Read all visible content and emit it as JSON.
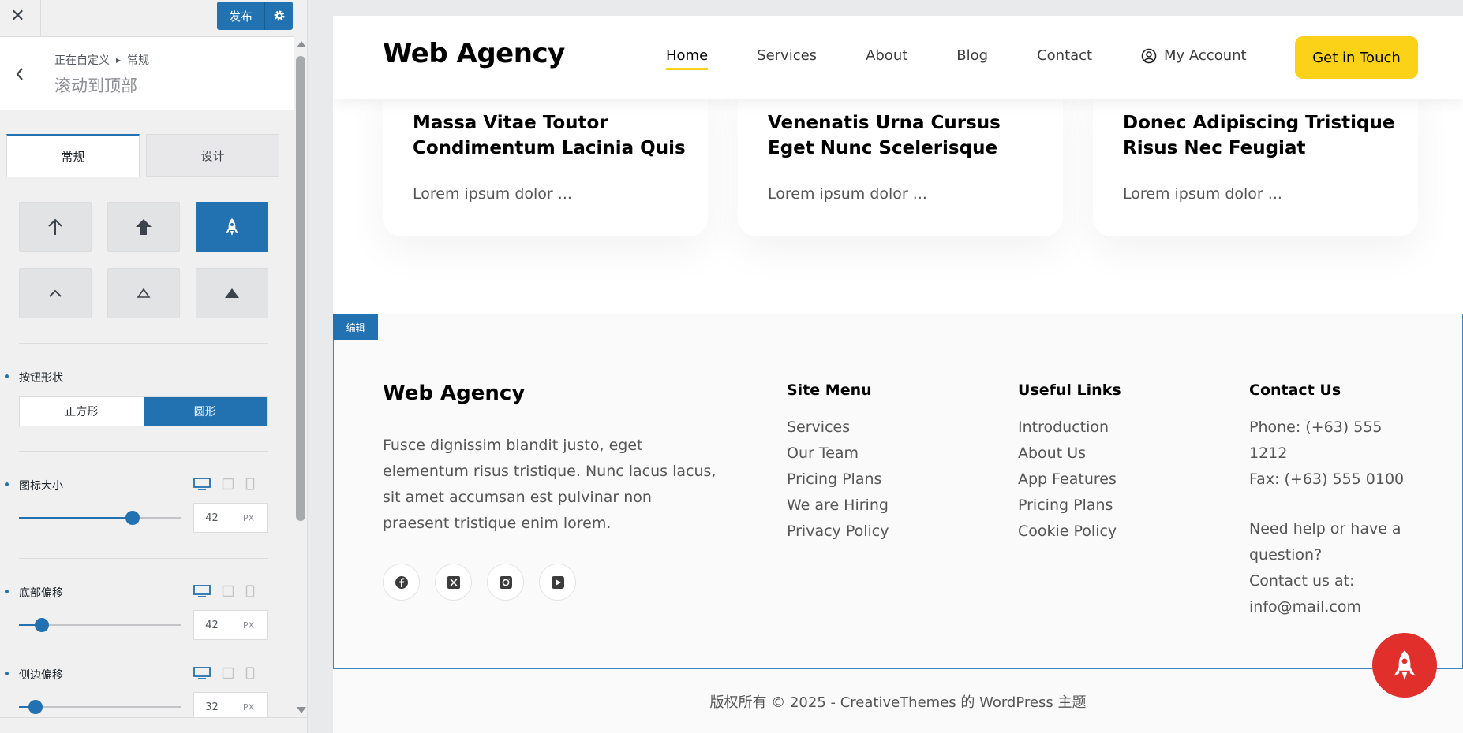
{
  "customizer": {
    "close_glyph": "✕",
    "publish_label": "发布",
    "breadcrumb": [
      "正在自定义",
      "常规"
    ],
    "section_title": "滚动到顶部",
    "tabs": [
      "常规",
      "设计"
    ],
    "accent_color": "#2271b1",
    "icon_options": [
      "arrow-up-thin-icon",
      "arrow-up-bold-icon",
      "rocket-icon",
      "chevron-up-icon",
      "triangle-outline-up-icon",
      "triangle-solid-up-icon"
    ],
    "selected_icon": "rocket-icon",
    "button_shape": {
      "label": "按钮形状",
      "options": [
        "正方形",
        "圆形"
      ],
      "selected": "圆形"
    },
    "icon_size": {
      "label": "图标大小",
      "value": "42",
      "unit": "PX",
      "level": 0.7
    },
    "bottom_offset": {
      "label": "底部偏移",
      "value": "42",
      "unit": "PX",
      "level": 0.14
    },
    "side_offset": {
      "label": "侧边偏移",
      "value": "32",
      "unit": "PX",
      "level": 0.1
    }
  },
  "site": {
    "logo": "Web Agency",
    "nav": [
      "Home",
      "Services",
      "About",
      "Blog",
      "Contact"
    ],
    "nav_current": "Home",
    "account": "My Account",
    "cta": "Get in Touch",
    "cta_color": "#fcd219",
    "cards": [
      {
        "title": "Massa Vitae Toutor Condimentum Lacinia Quis",
        "excerpt": "Lorem ipsum dolor ..."
      },
      {
        "title": "Venenatis Urna Cursus Eget Nunc Scelerisque",
        "excerpt": "Lorem ipsum dolor ..."
      },
      {
        "title": "Donec Adipiscing Tristique Risus Nec Feugiat",
        "excerpt": "Lorem ipsum dolor ..."
      }
    ],
    "footer": {
      "edit_tag": "编辑",
      "logo": "Web Agency",
      "description": "Fusce dignissim blandit justo, eget elementum risus tristique. Nunc lacus lacus, sit amet accumsan est pulvinar non praesent tristique enim lorem.",
      "socials": [
        "facebook-icon",
        "x-icon",
        "instagram-icon",
        "youtube-icon"
      ],
      "site_menu": {
        "heading": "Site Menu",
        "links": [
          "Services",
          "Our Team",
          "Pricing Plans",
          "We are Hiring",
          "Privacy Policy"
        ]
      },
      "useful_links": {
        "heading": "Useful Links",
        "links": [
          "Introduction",
          "About Us",
          "App Features",
          "Pricing Plans",
          "Cookie Policy"
        ]
      },
      "contact": {
        "heading": "Contact Us",
        "phone": "Phone: (+63) 555 1212",
        "fax": "Fax: (+63) 555 0100",
        "help": "Need help or have a question?",
        "contact_line": "Contact us at:",
        "email": "info@mail.com"
      }
    },
    "copyright": "版权所有 © 2025 - CreativeThemes 的 WordPress 主题",
    "to_top_color": "#e12f2b"
  }
}
